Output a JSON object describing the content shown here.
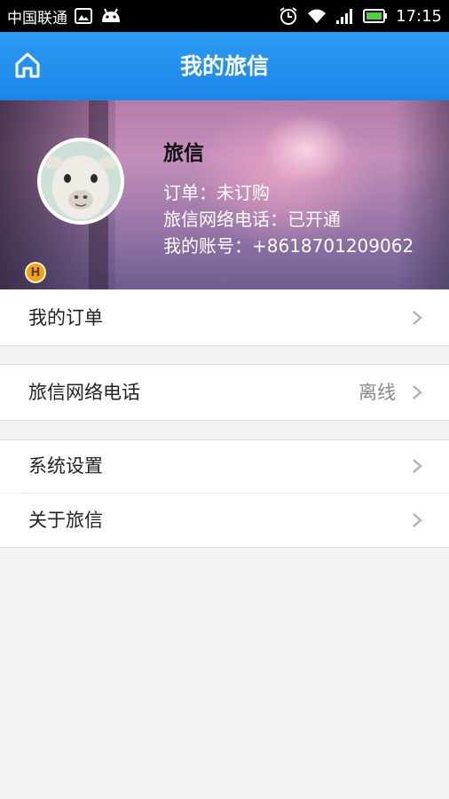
{
  "status_bar": {
    "carrier": "中国联通",
    "time": "17:15",
    "icons": [
      "image-icon",
      "android-icon",
      "alarm-icon",
      "wifi-icon",
      "signal-icon",
      "battery-icon"
    ]
  },
  "header": {
    "title": "我的旅信",
    "home_icon": "home-icon",
    "color": "#2193ee"
  },
  "profile": {
    "name": "旅信",
    "order_status": "订单：未订购",
    "phone_status": "旅信网络电话：已开通",
    "account": "我的账号：+8618701209062",
    "badge": "H"
  },
  "menu": {
    "my_orders": {
      "label": "我的订单"
    },
    "network_phone": {
      "label": "旅信网络电话",
      "value": "离线"
    },
    "settings": {
      "label": "系统设置"
    },
    "about": {
      "label": "关于旅信"
    }
  }
}
